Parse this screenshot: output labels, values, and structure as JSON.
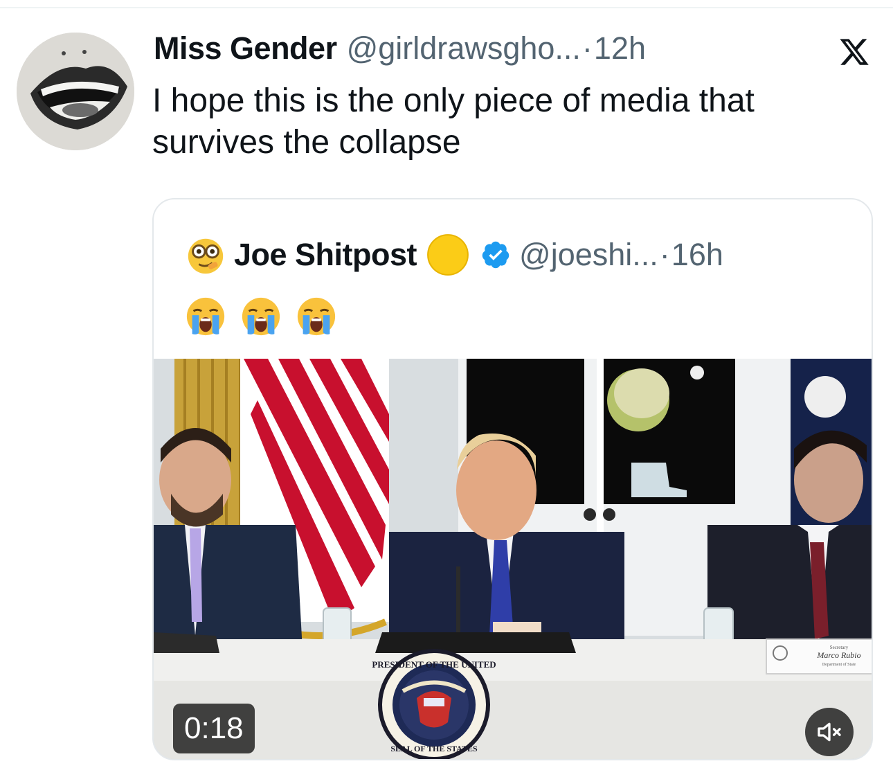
{
  "tweet": {
    "author_name": "Miss Gender",
    "author_handle": "@girldrawsgho...",
    "separator": "·",
    "time": "12h",
    "text": "I hope this is the only piece of media that survives the collapse",
    "avatar_icon": "mouth-avatar-icon",
    "platform_icon": "x-logo-icon"
  },
  "quote": {
    "author_name": "Joe Shitpost",
    "author_handle": "@joeshi...",
    "separator": "·",
    "time": "16h",
    "avatar_icon": "nerd-face-emoji-icon",
    "badge_icon": "yellow-circle-emoji-icon",
    "verified_icon": "verified-badge-icon",
    "verified_color": "#1d9bf0",
    "body_emojis": [
      "loudly-crying-face-emoji",
      "loudly-crying-face-emoji",
      "loudly-crying-face-emoji"
    ],
    "video": {
      "duration": "0:18",
      "mute_icon": "speaker-muted-icon",
      "seal_text_top": "PRESIDENT OF THE UNITED",
      "seal_text_bottom": "SEAL OF THE STATES",
      "nameplate_title": "Secretary",
      "nameplate_name": "Marco Rubio",
      "nameplate_dept": "Department of State"
    }
  },
  "colors": {
    "text_primary": "#0f1419",
    "text_secondary": "#536471",
    "border": "#e4e8eb"
  }
}
